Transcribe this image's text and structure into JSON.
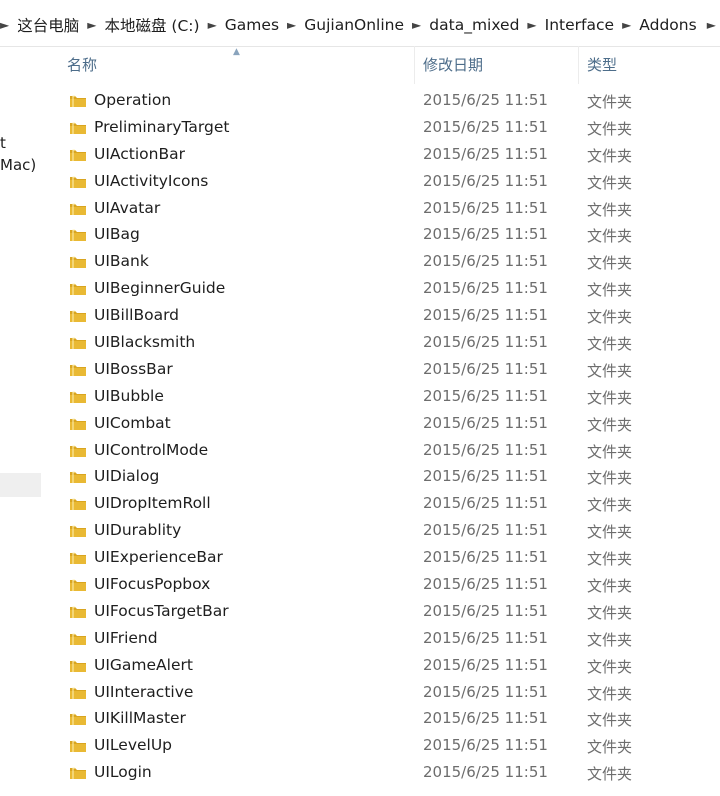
{
  "breadcrumb": {
    "items": [
      "这台电脑",
      "本地磁盘 (C:)",
      "Games",
      "GujianOnline",
      "data_mixed",
      "Interface",
      "Addons"
    ]
  },
  "navpane": {
    "fragments": [
      "t",
      "Mac)"
    ]
  },
  "columns": {
    "name": "名称",
    "date": "修改日期",
    "type": "类型"
  },
  "colors": {
    "folder": "#e9b934",
    "header_text": "#4d6d8a"
  },
  "files": [
    {
      "name": "Operation",
      "date": "2015/6/25 11:51",
      "type": "文件夹"
    },
    {
      "name": "PreliminaryTarget",
      "date": "2015/6/25 11:51",
      "type": "文件夹"
    },
    {
      "name": "UIActionBar",
      "date": "2015/6/25 11:51",
      "type": "文件夹"
    },
    {
      "name": "UIActivityIcons",
      "date": "2015/6/25 11:51",
      "type": "文件夹"
    },
    {
      "name": "UIAvatar",
      "date": "2015/6/25 11:51",
      "type": "文件夹"
    },
    {
      "name": "UIBag",
      "date": "2015/6/25 11:51",
      "type": "文件夹"
    },
    {
      "name": "UIBank",
      "date": "2015/6/25 11:51",
      "type": "文件夹"
    },
    {
      "name": "UIBeginnerGuide",
      "date": "2015/6/25 11:51",
      "type": "文件夹"
    },
    {
      "name": "UIBillBoard",
      "date": "2015/6/25 11:51",
      "type": "文件夹"
    },
    {
      "name": "UIBlacksmith",
      "date": "2015/6/25 11:51",
      "type": "文件夹"
    },
    {
      "name": "UIBossBar",
      "date": "2015/6/25 11:51",
      "type": "文件夹"
    },
    {
      "name": "UIBubble",
      "date": "2015/6/25 11:51",
      "type": "文件夹"
    },
    {
      "name": "UICombat",
      "date": "2015/6/25 11:51",
      "type": "文件夹"
    },
    {
      "name": "UIControlMode",
      "date": "2015/6/25 11:51",
      "type": "文件夹"
    },
    {
      "name": "UIDialog",
      "date": "2015/6/25 11:51",
      "type": "文件夹"
    },
    {
      "name": "UIDropItemRoll",
      "date": "2015/6/25 11:51",
      "type": "文件夹"
    },
    {
      "name": "UIDurablity",
      "date": "2015/6/25 11:51",
      "type": "文件夹"
    },
    {
      "name": "UIExperienceBar",
      "date": "2015/6/25 11:51",
      "type": "文件夹"
    },
    {
      "name": "UIFocusPopbox",
      "date": "2015/6/25 11:51",
      "type": "文件夹"
    },
    {
      "name": "UIFocusTargetBar",
      "date": "2015/6/25 11:51",
      "type": "文件夹"
    },
    {
      "name": "UIFriend",
      "date": "2015/6/25 11:51",
      "type": "文件夹"
    },
    {
      "name": "UIGameAlert",
      "date": "2015/6/25 11:51",
      "type": "文件夹"
    },
    {
      "name": "UIInteractive",
      "date": "2015/6/25 11:51",
      "type": "文件夹"
    },
    {
      "name": "UIKillMaster",
      "date": "2015/6/25 11:51",
      "type": "文件夹"
    },
    {
      "name": "UILevelUp",
      "date": "2015/6/25 11:51",
      "type": "文件夹"
    },
    {
      "name": "UILogin",
      "date": "2015/6/25 11:51",
      "type": "文件夹"
    }
  ]
}
